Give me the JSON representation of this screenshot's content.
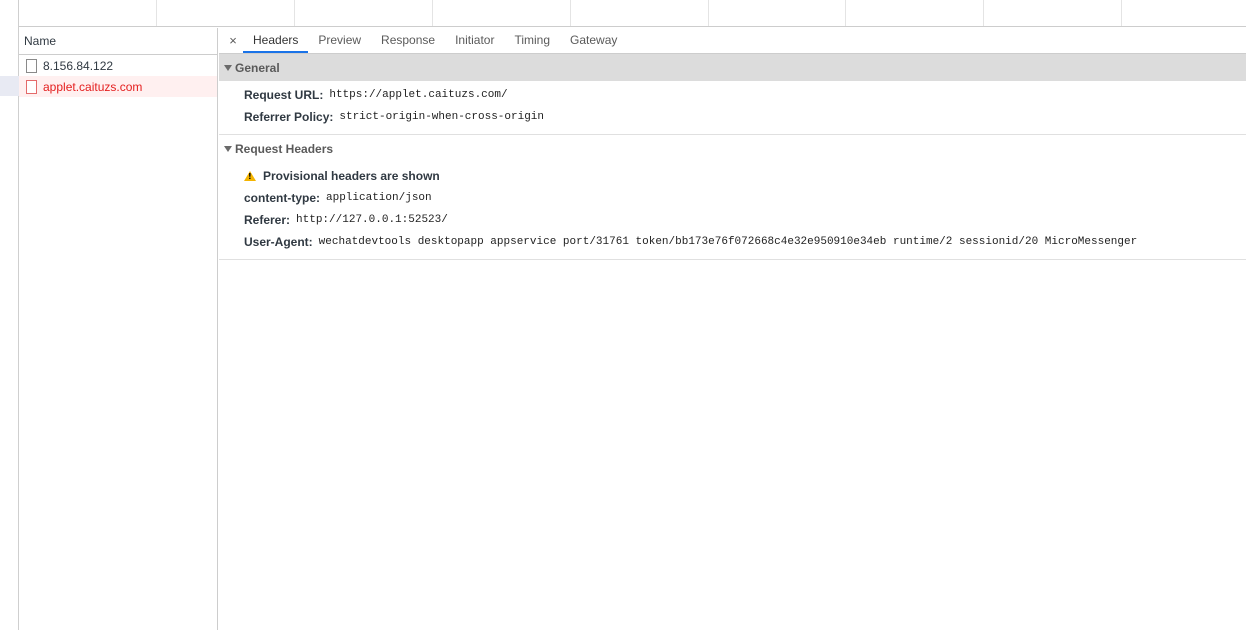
{
  "request_list": {
    "column_header": "Name",
    "rows": [
      {
        "name": "8.156.84.122",
        "status": "normal"
      },
      {
        "name": "applet.caituzs.com",
        "status": "error"
      }
    ]
  },
  "detail": {
    "close_symbol": "×",
    "tabs": [
      "Headers",
      "Preview",
      "Response",
      "Initiator",
      "Timing",
      "Gateway"
    ],
    "active_tab": "Headers",
    "general": {
      "title": "General",
      "rows": [
        {
          "key": "Request URL:",
          "value": "https://applet.caituzs.com/"
        },
        {
          "key": "Referrer Policy:",
          "value": "strict-origin-when-cross-origin"
        }
      ]
    },
    "request_headers": {
      "title": "Request Headers",
      "warning": "Provisional headers are shown",
      "rows": [
        {
          "key": "content-type:",
          "value": "application/json"
        },
        {
          "key": "Referer:",
          "value": "http://127.0.0.1:52523/"
        },
        {
          "key": "User-Agent:",
          "value": "wechatdevtools desktopapp appservice port/31761 token/bb173e76f072668c4e32e950910e34eb runtime/2 sessionid/20 MicroMessenger"
        }
      ]
    }
  },
  "colors": {
    "error_text": "#e41e1e",
    "active_tab_underline": "#1a73e8",
    "warning_icon": "#f4b400"
  }
}
